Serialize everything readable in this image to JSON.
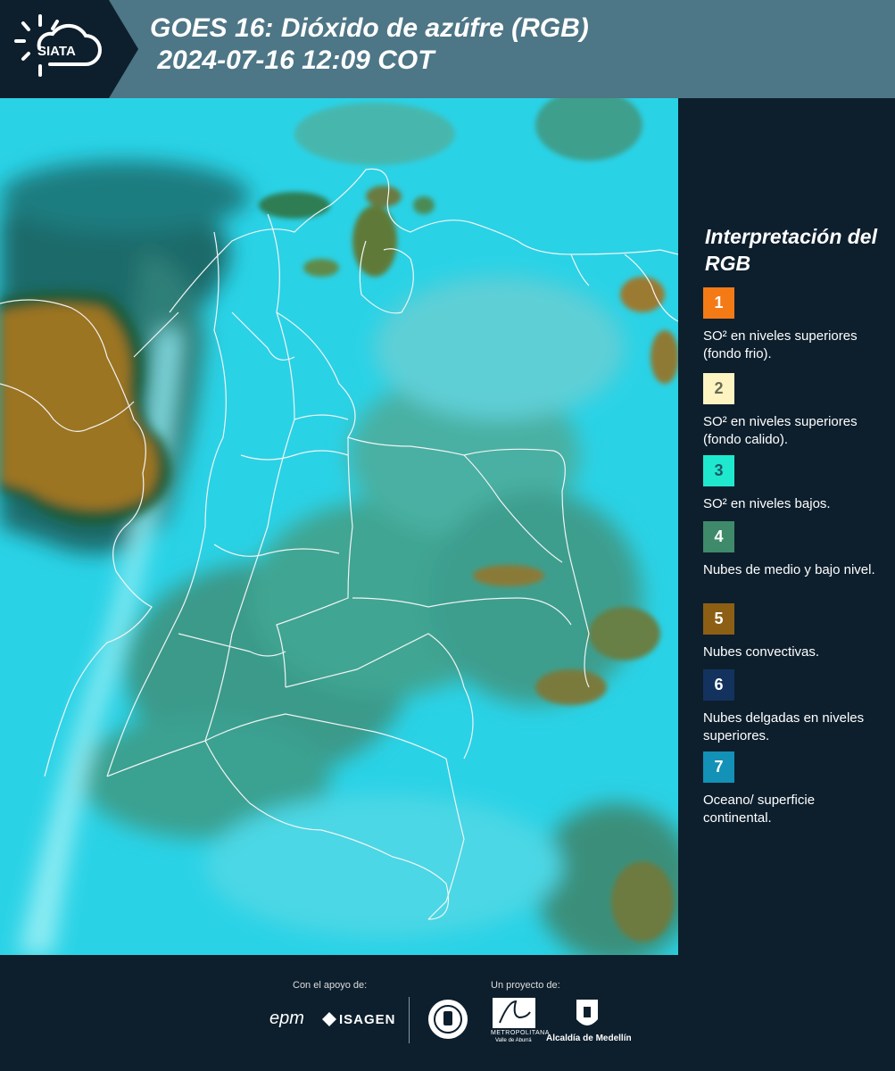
{
  "header": {
    "logo_text": "SIATA",
    "title": "GOES 16: Dióxido de azúfre (RGB)\n 2024-07-16 12:09 COT"
  },
  "map": {
    "region": "Colombia and surroundings",
    "background_color": "#27cfe3"
  },
  "legend": {
    "title": "Interpretación del RGB",
    "items": [
      {
        "number": "1",
        "color": "#f47a16",
        "text_color": "#ffffff",
        "description": "SO² en niveles superiores (fondo frio)."
      },
      {
        "number": "2",
        "color": "#fdf4c2",
        "text_color": "#6a6a55",
        "description": "SO² en niveles superiores (fondo calido)."
      },
      {
        "number": "3",
        "color": "#1ee9cf",
        "text_color": "#1c5a64",
        "description": "SO² en niveles bajos."
      },
      {
        "number": "4",
        "color": "#3e8a6a",
        "text_color": "#ffffff",
        "description": "Nubes de medio y bajo nivel."
      },
      {
        "number": "5",
        "color": "#8c5f14",
        "text_color": "#ffffff",
        "description": "Nubes convectivas."
      },
      {
        "number": "6",
        "color": "#13325e",
        "text_color": "#ffffff",
        "description": "Nubes delgadas en niveles superiores."
      },
      {
        "number": "7",
        "color": "#1391b6",
        "text_color": "#ffffff",
        "description": "Oceano/ superficie continental."
      }
    ]
  },
  "footer": {
    "support_label": "Con el apoyo de:",
    "project_label": "Un proyecto de:",
    "sponsors": [
      "epm",
      "ISAGEN"
    ],
    "partners": [
      "Medellín",
      "Área Metropolitana",
      "Alcaldía de Medellín"
    ],
    "area_sub": "METROPOLITANA",
    "area_sub2": "Valle de Aburrá",
    "alcaldia": "Alcaldía de Medellín",
    "isagen": "ISAGEN",
    "epm": "epm"
  }
}
